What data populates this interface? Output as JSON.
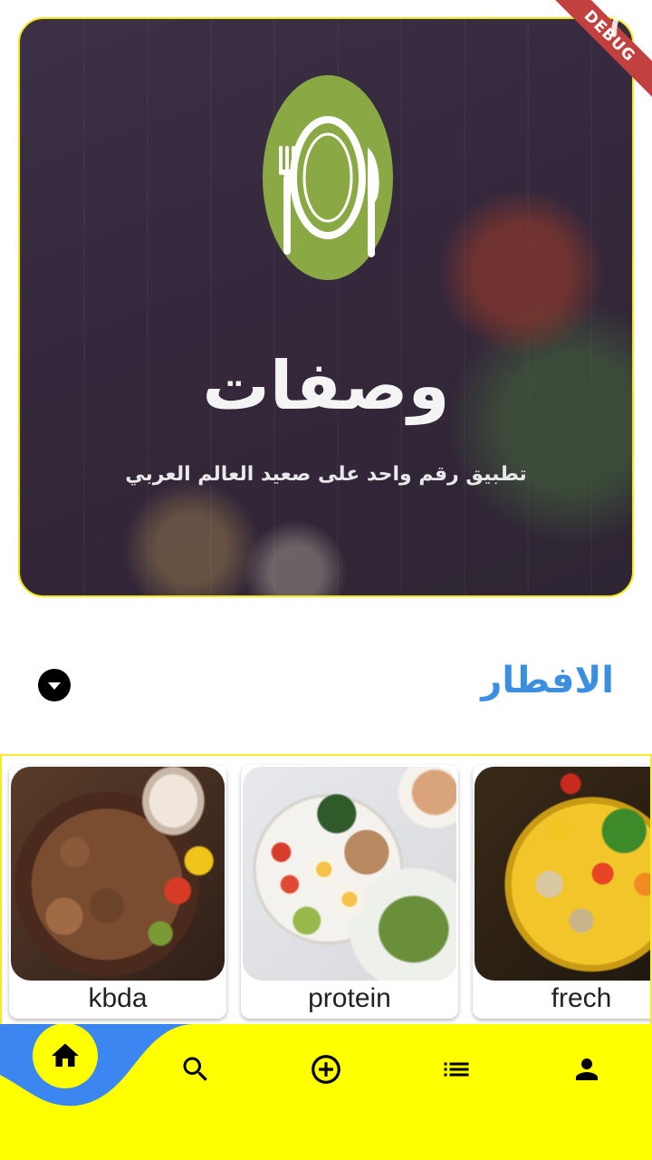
{
  "hero": {
    "title": "وصفات",
    "tagline": "تطبيق رقم واحد على صعيد العالم العربي",
    "logo_icon": "plate-fork-knife-icon",
    "logo_color": "#8aa844",
    "border_color": "#f5e616"
  },
  "debug_banner": {
    "label": "DEBUG",
    "color": "#c2403e"
  },
  "section": {
    "title": "الافطار",
    "title_color": "#3a8fe0",
    "dropdown_icon": "arrow-drop-down-circle-icon"
  },
  "recipes": [
    {
      "name": "kbda"
    },
    {
      "name": "protein"
    },
    {
      "name": "frech"
    }
  ],
  "bottom_nav": {
    "background": "#ffff00",
    "accent": "#3b86f0",
    "items": [
      {
        "name": "home",
        "icon": "home-icon",
        "active": true
      },
      {
        "name": "search",
        "icon": "search-icon",
        "active": false
      },
      {
        "name": "add",
        "icon": "add-circle-icon",
        "active": false
      },
      {
        "name": "list",
        "icon": "list-icon",
        "active": false
      },
      {
        "name": "profile",
        "icon": "person-icon",
        "active": false
      }
    ]
  }
}
